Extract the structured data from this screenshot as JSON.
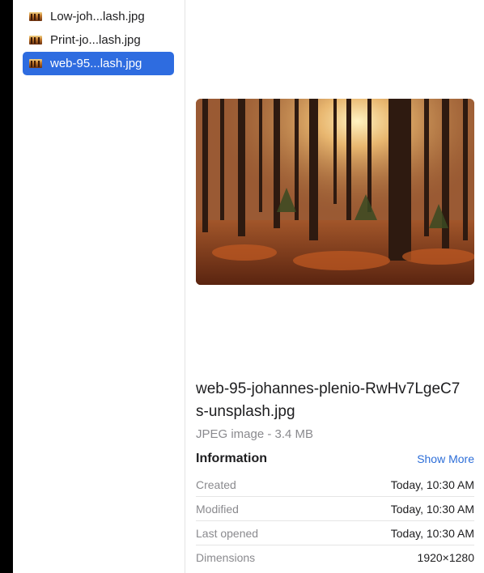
{
  "files": [
    {
      "label": "Low-joh...lash.jpg",
      "icon": "image-file-icon",
      "selected": false
    },
    {
      "label": "Print-jo...lash.jpg",
      "icon": "image-file-icon",
      "selected": false
    },
    {
      "label": "web-95...lash.jpg",
      "icon": "image-file-icon",
      "selected": true
    }
  ],
  "preview": {
    "file_name": "web-95-johannes-plenio-RwHv7LgeC7s-unsplash.jpg",
    "kind": "JPEG image - 3.4 MB"
  },
  "info": {
    "title": "Information",
    "show_more": "Show More",
    "rows": [
      {
        "key": "Created",
        "value": "Today, 10:30 AM"
      },
      {
        "key": "Modified",
        "value": "Today, 10:30 AM"
      },
      {
        "key": "Last opened",
        "value": "Today, 10:30 AM"
      },
      {
        "key": "Dimensions",
        "value": "1920×1280"
      }
    ]
  },
  "colors": {
    "selection": "#2e6ce0",
    "link": "#2d6ed8"
  }
}
